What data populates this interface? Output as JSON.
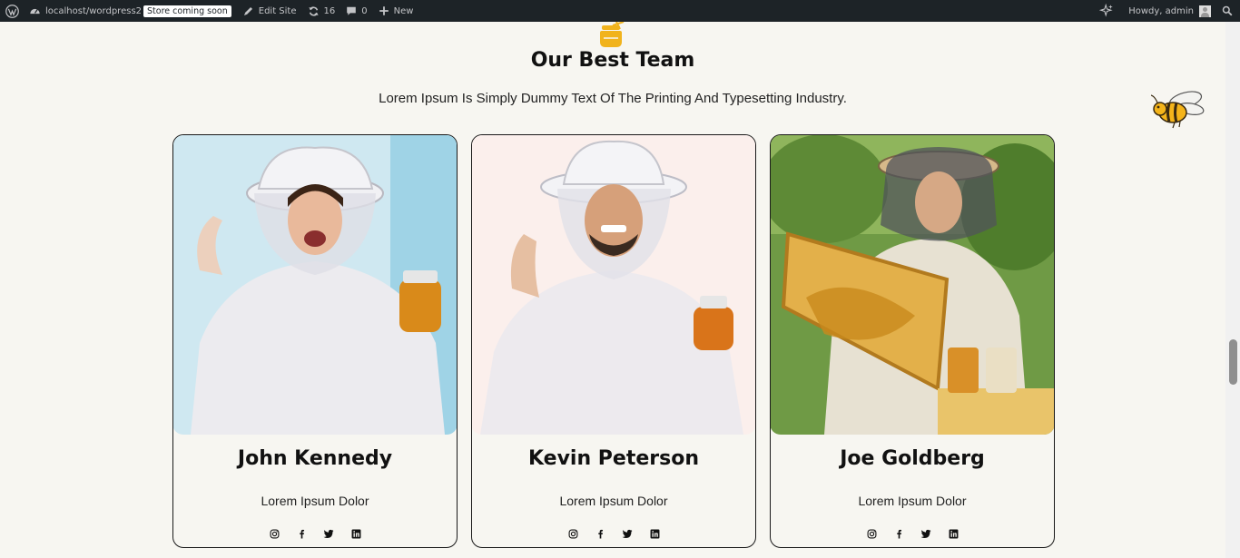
{
  "adminbar": {
    "site": "localhost/wordpress2",
    "badge": "Store coming soon",
    "edit_site": "Edit Site",
    "updates": "16",
    "comments": "0",
    "new": "New",
    "howdy": "Howdy, admin",
    "icons": [
      "wordpress-logo-icon",
      "dashboard-icon",
      "edit-icon",
      "updates-icon",
      "comment-icon",
      "plus-icon",
      "sparkle-icon",
      "search-icon"
    ]
  },
  "section": {
    "title": "Our Best Team",
    "subtitle": "Lorem Ipsum Is Simply Dummy Text Of The Printing And Typesetting Industry."
  },
  "team": [
    {
      "name": "John Kennedy",
      "role": "Lorem Ipsum Dolor",
      "photo_bg": "#cfe8f1"
    },
    {
      "name": "Kevin Peterson",
      "role": "Lorem Ipsum Dolor",
      "photo_bg": "#fbefec"
    },
    {
      "name": "Joe Goldberg",
      "role": "Lorem Ipsum Dolor",
      "photo_bg": "#6f9a45"
    }
  ],
  "socials": [
    "instagram-icon",
    "facebook-icon",
    "twitter-icon",
    "linkedin-icon"
  ],
  "colors": {
    "adminbar": "#1d2327",
    "page_bg": "#f7f6f1",
    "honey": "#f1b31c",
    "text": "#111111"
  }
}
